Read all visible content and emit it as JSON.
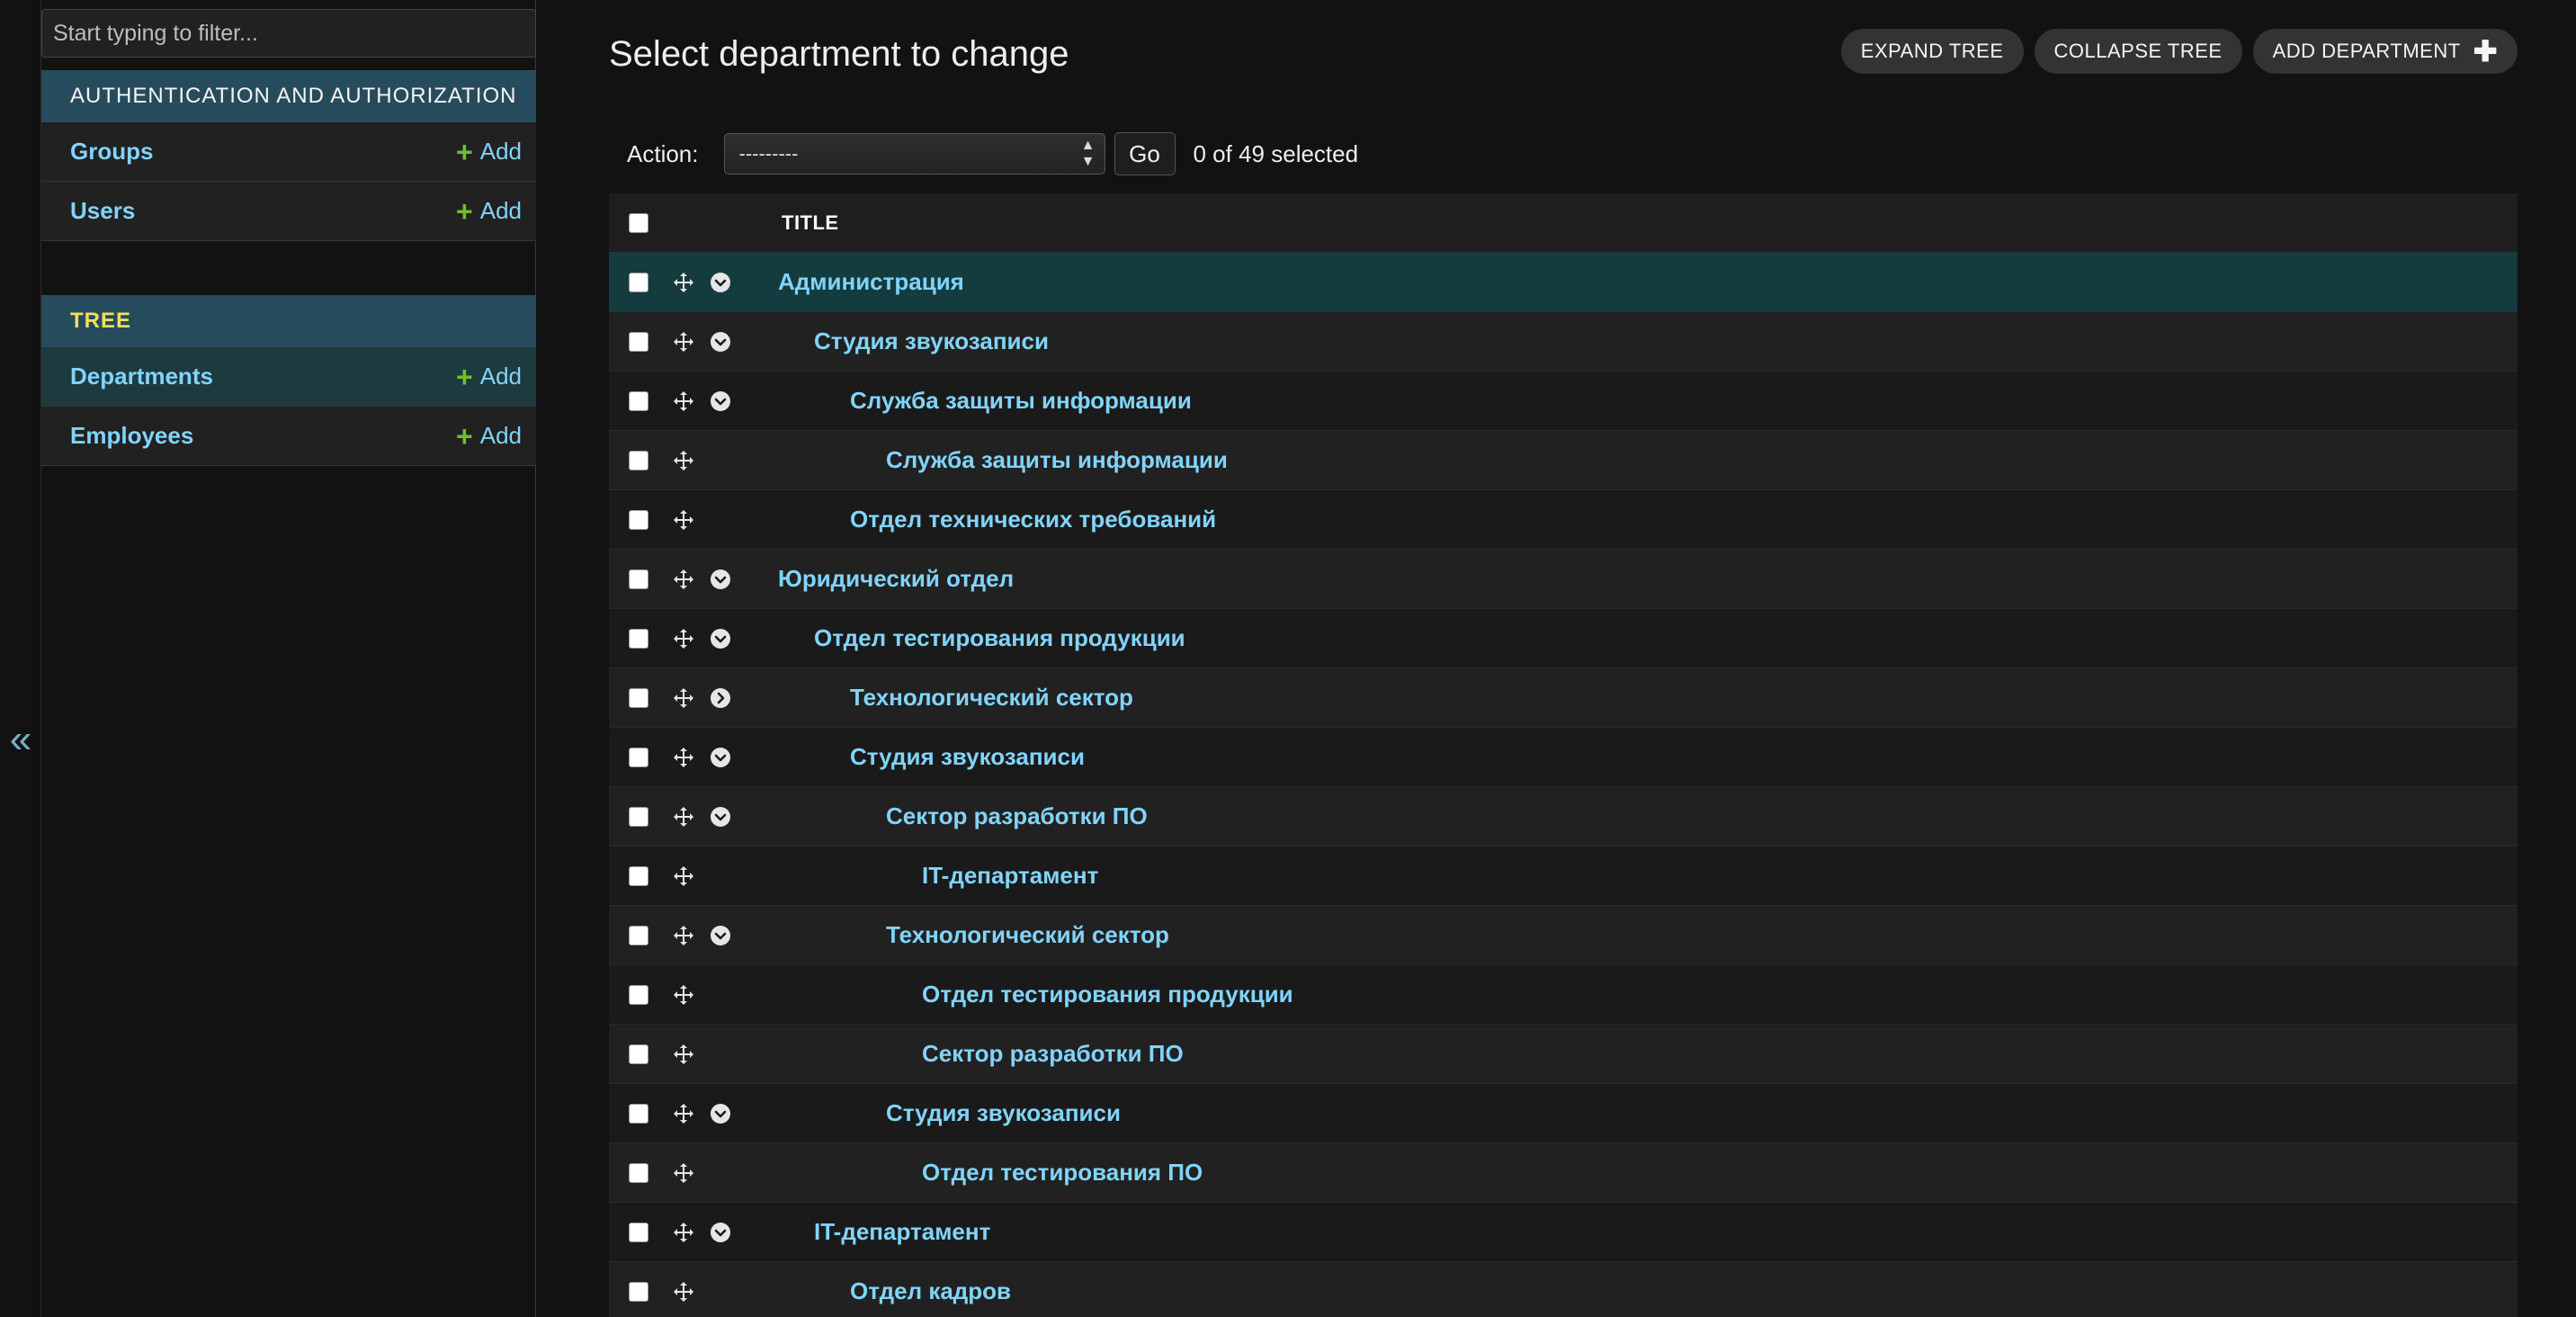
{
  "sidebar": {
    "filter_placeholder": "Start typing to filter...",
    "collapse_label": "«",
    "apps": [
      {
        "name": "AUTHENTICATION AND AUTHORIZATION",
        "models": [
          {
            "name": "Groups",
            "add": "Add"
          },
          {
            "name": "Users",
            "add": "Add"
          }
        ]
      },
      {
        "name": "TREE",
        "models": [
          {
            "name": "Departments",
            "add": "Add"
          },
          {
            "name": "Employees",
            "add": "Add"
          }
        ]
      }
    ]
  },
  "main": {
    "title": "Select department to change",
    "tools": {
      "expand": "EXPAND TREE",
      "collapse": "COLLAPSE TREE",
      "add": "ADD DEPARTMENT"
    },
    "actions": {
      "label": "Action:",
      "selected_value": "---------",
      "go": "Go",
      "counter": "0 of 49 selected"
    },
    "table": {
      "header_title": "TITLE",
      "rows": [
        {
          "title": "Администрация",
          "level": 0,
          "toggle": "expanded"
        },
        {
          "title": "Студия звукозаписи",
          "level": 1,
          "toggle": "expanded"
        },
        {
          "title": "Служба защиты информации",
          "level": 2,
          "toggle": "expanded"
        },
        {
          "title": "Служба защиты информации",
          "level": 3,
          "toggle": "none"
        },
        {
          "title": "Отдел технических требований",
          "level": 2,
          "toggle": "none"
        },
        {
          "title": "Юридический отдел",
          "level": 0,
          "toggle": "expanded"
        },
        {
          "title": "Отдел тестирования продукции",
          "level": 1,
          "toggle": "expanded"
        },
        {
          "title": "Технологический сектор",
          "level": 2,
          "toggle": "collapsed"
        },
        {
          "title": "Студия звукозаписи",
          "level": 2,
          "toggle": "expanded"
        },
        {
          "title": "Сектор разработки ПО",
          "level": 3,
          "toggle": "expanded"
        },
        {
          "title": "IT-департамент",
          "level": 4,
          "toggle": "none"
        },
        {
          "title": "Технологический сектор",
          "level": 3,
          "toggle": "expanded"
        },
        {
          "title": "Отдел тестирования продукции",
          "level": 4,
          "toggle": "none"
        },
        {
          "title": "Сектор разработки ПО",
          "level": 4,
          "toggle": "none"
        },
        {
          "title": "Студия звукозаписи",
          "level": 3,
          "toggle": "expanded"
        },
        {
          "title": "Отдел тестирования ПО",
          "level": 4,
          "toggle": "none"
        },
        {
          "title": "IT-департамент",
          "level": 1,
          "toggle": "expanded"
        },
        {
          "title": "Отдел кадров",
          "level": 2,
          "toggle": "none"
        }
      ]
    }
  },
  "colors": {
    "link": "#81d4fa",
    "module_header": "#264b5d",
    "add_plus": "#70bf2b",
    "highlight_row": "#143b3e"
  }
}
